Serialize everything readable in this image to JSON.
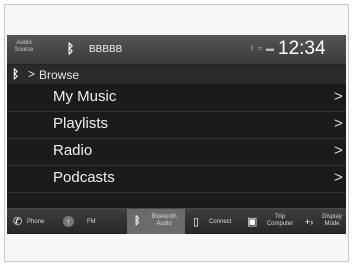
{
  "status_bar": {
    "audio_source": "Audio Source",
    "device_name": "BBBBB",
    "status_icons": "I ≈ ▬",
    "clock": "12:34"
  },
  "breadcrumb": {
    "separator": ">",
    "label": "Browse"
  },
  "list": {
    "items": [
      {
        "label": "My Music"
      },
      {
        "label": "Playlists"
      },
      {
        "label": "Radio"
      },
      {
        "label": "Podcasts"
      }
    ],
    "chevron": ">"
  },
  "navbar": {
    "phone": "Phone",
    "fm": "FM",
    "bluetooth_audio_line1": "Bluetooth",
    "bluetooth_audio_line2": "Audio",
    "connect": "Connect",
    "trip_line1": "Trip",
    "trip_line2": "Computer",
    "display_line1": "Display",
    "display_line2": "Mode"
  },
  "icons": {
    "bluetooth": "bluetooth-icon",
    "phone": "phone-icon",
    "fm": "radio-icon",
    "connect": "connect-icon",
    "trip": "trip-computer-icon",
    "display": "display-mode-icon"
  },
  "colors": {
    "screen_bg": "#1b1b1b",
    "active_tab": "#6b6b6b"
  }
}
